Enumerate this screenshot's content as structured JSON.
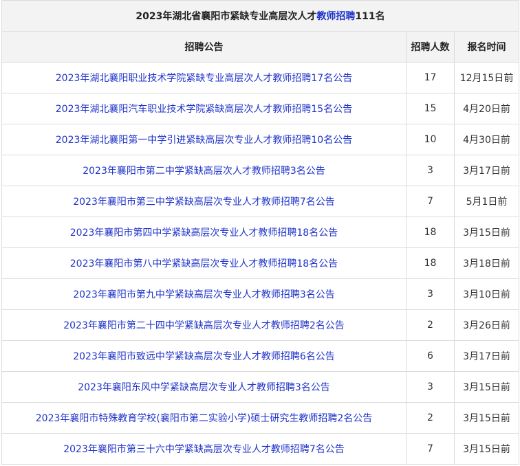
{
  "caption": {
    "prefix": "2023年湖北省襄阳市紧缺专业高层次人才",
    "highlight": "教师招聘",
    "suffix": "111名"
  },
  "headers": {
    "notice": "招聘公告",
    "count": "招聘人数",
    "deadline": "报名时间"
  },
  "rows": [
    {
      "title": "2023年湖北襄阳职业技术学院紧缺专业高层次人才教师招聘17名公告",
      "count": "17",
      "deadline": "12月15日前"
    },
    {
      "title": "2023年湖北襄阳汽车职业技术学院紧缺高层次人才教师招聘15名公告",
      "count": "15",
      "deadline": "4月20日前"
    },
    {
      "title": "2023年湖北襄阳第一中学引进紧缺高层次专业人才教师招聘10名公告",
      "count": "10",
      "deadline": "4月30日前"
    },
    {
      "title": "2023年襄阳市第二中学紧缺高层次人才教师招聘3名公告",
      "count": "3",
      "deadline": "3月17日前"
    },
    {
      "title": "2023年襄阳市第三中学紧缺高层次专业人才教师招聘7名公告",
      "count": "7",
      "deadline": "5月1日前"
    },
    {
      "title": "2023年襄阳市第四中学紧缺高层次专业人才教师招聘18名公告",
      "count": "18",
      "deadline": "3月15日前"
    },
    {
      "title": "2023年襄阳市第八中学紧缺高层次专业人才教师招聘18名公告",
      "count": "18",
      "deadline": "3月18日前"
    },
    {
      "title": "2023年襄阳市第九中学紧缺高层次专业人才教师招聘3名公告",
      "count": "3",
      "deadline": "3月10日前"
    },
    {
      "title": "2023年襄阳市第二十四中学紧缺高层次专业人才教师招聘2名公告",
      "count": "2",
      "deadline": "3月26日前"
    },
    {
      "title": "2023年襄阳市致远中学紧缺高层次专业人才教师招聘6名公告",
      "count": "6",
      "deadline": "3月17日前"
    },
    {
      "title": "2023年襄阳东风中学紧缺高层次专业人才教师招聘3名公告",
      "count": "3",
      "deadline": "3月15日前"
    },
    {
      "title": "2023年襄阳市特殊教育学校(襄阳市第二实验小学)硕士研究生教师招聘2名公告",
      "count": "2",
      "deadline": "3月15日前"
    },
    {
      "title": "2023年襄阳市第三十六中学紧缺高层次专业人才教师招聘7名公告",
      "count": "7",
      "deadline": "3月15日前"
    }
  ]
}
